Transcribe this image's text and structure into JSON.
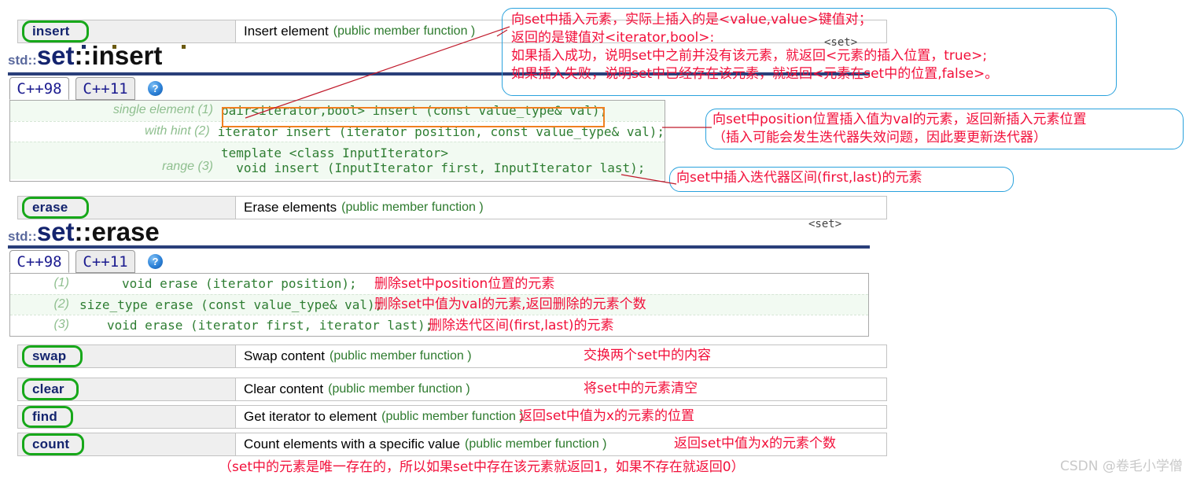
{
  "insert_section": {
    "row": {
      "name": "insert",
      "desc_main": "Insert element",
      "desc_sub": "(public member function )"
    },
    "title": {
      "std": "std::",
      "set": "set",
      "rest": "::insert"
    },
    "header_tag": "<set>",
    "tabs": [
      {
        "label": "C++98",
        "state": "active"
      },
      {
        "label": "C++11",
        "state": "inactive"
      }
    ],
    "help_icon_label": "?",
    "signatures": [
      {
        "label": "single element (1)",
        "code": "pair<iterator,bool> insert (const value_type& val);"
      },
      {
        "label": "with hint (2)",
        "code": "iterator insert (iterator position, const value_type& val);"
      },
      {
        "label": "range (3)",
        "code": "template <class InputIterator>\n  void insert (InputIterator first, InputIterator last);"
      }
    ]
  },
  "erase_section": {
    "row": {
      "name": "erase",
      "desc_main": "Erase elements",
      "desc_sub": "(public member function )"
    },
    "title": {
      "std": "std::",
      "set": "set",
      "rest": "::erase"
    },
    "header_tag": "<set>",
    "tabs": [
      {
        "label": "C++98",
        "state": "active"
      },
      {
        "label": "C++11",
        "state": "inactive"
      }
    ],
    "help_icon_label": "?",
    "ghost_watermark": "C++98",
    "signatures": [
      {
        "label": "(1)",
        "code": "void erase (iterator position);"
      },
      {
        "label": "(2)",
        "code": "size_type erase (const value_type& val);"
      },
      {
        "label": "(3)",
        "code": "void erase (iterator first, iterator last);"
      }
    ],
    "annotations": [
      "删除set中position位置的元素",
      "删除set中值为val的元素,返回删除的元素个数",
      "删除迭代区间(first,last)的元素"
    ]
  },
  "other_rows": [
    {
      "name": "swap",
      "desc_main": "Swap content",
      "desc_sub": "(public member function )",
      "annotation": "交换两个set中的内容"
    },
    {
      "name": "clear",
      "desc_main": "Clear content",
      "desc_sub": "(public member function )",
      "annotation": "将set中的元素清空"
    },
    {
      "name": "find",
      "desc_main": "Get iterator to element",
      "desc_sub": "(public member function )",
      "annotation": "返回set中值为x的元素的位置"
    },
    {
      "name": "count",
      "desc_main": "Count elements with a specific value",
      "desc_sub": "(public member function )",
      "annotation": "返回set中值为x的元素个数"
    }
  ],
  "callouts": {
    "insert_return": [
      "向set中插入元素，实际上插入的是<value,value>键值对；",
      "返回的是键值对<iterator,bool>:",
      "如果插入成功，说明set中之前并没有该元素，就返回<元素的插入位置，true>;",
      "如果插入失败，说明set中已经存在该元素，就返回<元素在set中的位置,false>。"
    ],
    "insert_hint": [
      "向set中position位置插入值为val的元素，返回新插入元素位置",
      "（插入可能会发生迭代器失效问题，因此要更新迭代器）"
    ],
    "insert_range": [
      "向set中插入迭代器区间(first,last)的元素"
    ]
  },
  "footer_note": "（set中的元素是唯一存在的，所以如果set中存在该元素就返回1，如果不存在就返回0）",
  "watermark": "CSDN @卷毛小学僧",
  "colors": {
    "annotation_red": "#f20f3a",
    "callout_border_blue": "#2aa2dd",
    "name_ring_green": "#17a81a",
    "signature_ring_orange": "#f08020",
    "code_green": "#2e7d32",
    "title_blue": "#14246e",
    "rule_navy": "#2a3f7a"
  }
}
